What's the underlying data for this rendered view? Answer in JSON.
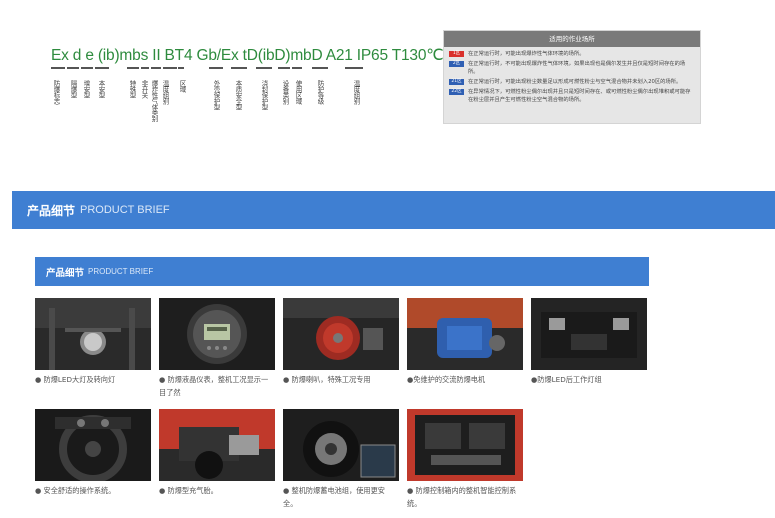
{
  "marking": {
    "code": "Ex d e (ib)mbs II BT4 Gb/Ex tD(ibD)mbD A21 IP65 T130℃",
    "labels": [
      "防爆标志",
      "隔爆型",
      "增安型",
      "本安型",
      "特殊型",
      "非开关",
      "爆炸性气体类别",
      "温度组别",
      "区域",
      "外壳保护型",
      "本质安全型",
      "浇封保护型",
      "设备类别",
      "使用区域",
      "防护等级",
      "温度组别"
    ]
  },
  "usage": {
    "title": "适用的作业场所",
    "rows": [
      {
        "tag": "1区",
        "color": "#d9302c",
        "text": "在正常运行时，可能出现爆炸性气体环境的场所。"
      },
      {
        "tag": "2区",
        "color": "#2f5fb3",
        "text": "在正常运行时，不可能出现爆炸性气体环境，如果出现也是偶尔发生并且仅是短时间存在的场所。"
      },
      {
        "tag": "21区",
        "color": "#2f5fb3",
        "text": "在正常运行时，可能出现粉尘数量足以形成可燃性粉尘与空气混合物并未划入20区的场所。"
      },
      {
        "tag": "22区",
        "color": "#2f5fb3",
        "text": "在异常情况下，可燃性粉尘偶尔出现并且只是短时间存在、或可燃性粉尘偶尔出现堆积或可能存在粉尘层并且产生可燃性粉尘空气混合物的场所。"
      }
    ]
  },
  "banner": {
    "cn": "产品细节",
    "en": "PRODUCT BRIEF"
  },
  "subbanner": {
    "cn": "产品细节",
    "en": "PRODUCT BRIEF"
  },
  "products": [
    {
      "caption": "● 防爆LED大灯及转向灯"
    },
    {
      "caption": "● 防爆液晶仪表，整机工况显示一目了然"
    },
    {
      "caption": "● 防爆喇叭，特殊工况专用"
    },
    {
      "caption": "●免维护的交流防爆电机"
    },
    {
      "caption": "●防爆LED后工作灯组"
    },
    {
      "caption": "● 安全舒适的操作系统。"
    },
    {
      "caption": "● 防爆型充气胎。"
    },
    {
      "caption": "● 整机防爆蓄电池组，使用更安全。"
    },
    {
      "caption": "● 防爆控制箱内的整机智能控制系统。"
    }
  ]
}
